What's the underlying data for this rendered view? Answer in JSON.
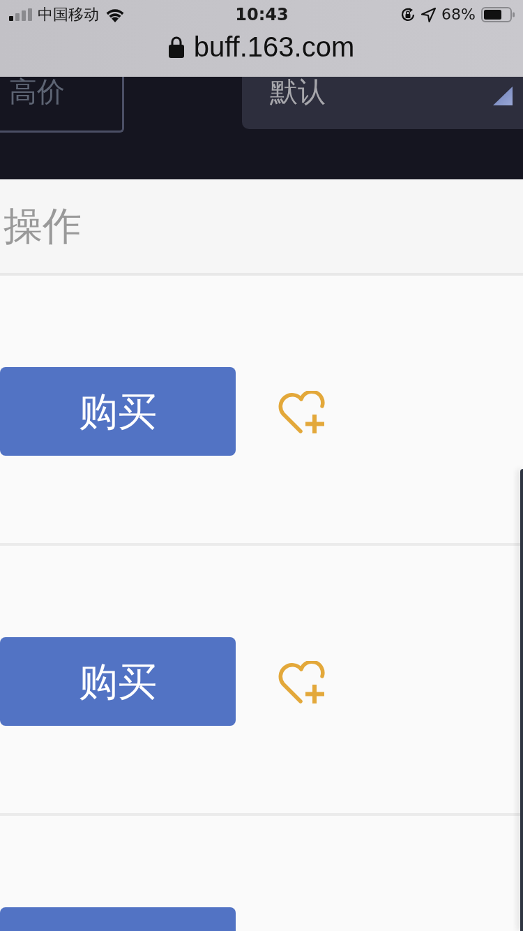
{
  "status_bar": {
    "carrier": "中国移动",
    "time": "10:43",
    "battery": "68%"
  },
  "address_bar": {
    "url": "buff.163.com"
  },
  "filter_bar": {
    "sort_button": "高价",
    "sort_select": {
      "value": "默认"
    }
  },
  "table": {
    "columns": [
      "操作"
    ],
    "rows": [
      {
        "kind": "full",
        "buy_button": "购买"
      },
      {
        "kind": "full",
        "buy_button": "购买"
      },
      {
        "kind": "partial"
      }
    ]
  }
}
